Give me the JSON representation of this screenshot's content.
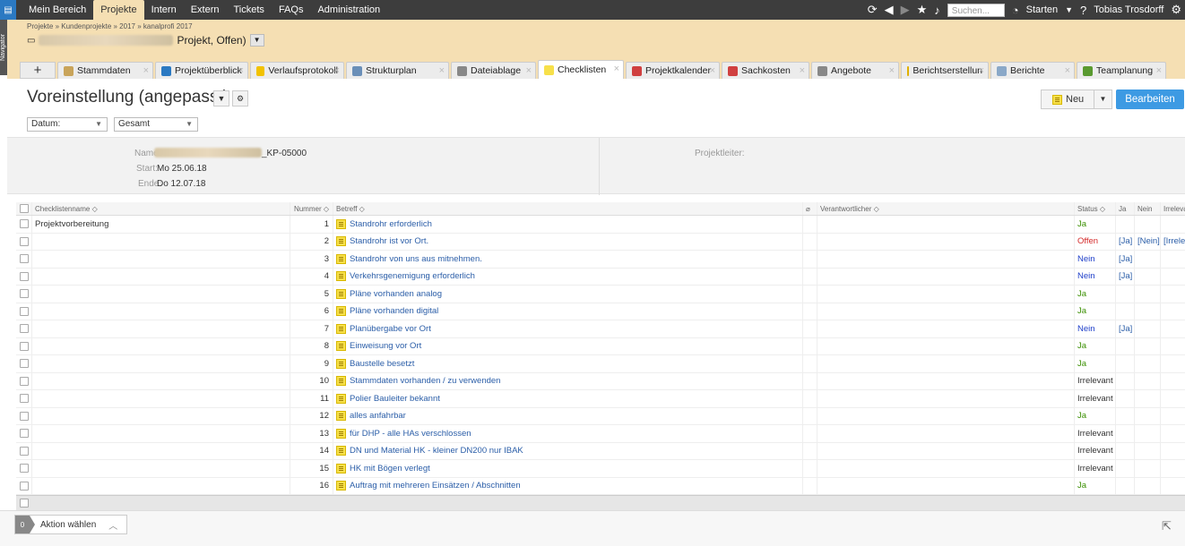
{
  "topnav": {
    "items": [
      "Mein Bereich",
      "Projekte",
      "Intern",
      "Extern",
      "Tickets",
      "FAQs",
      "Administration"
    ],
    "search_placeholder": "Suchen...",
    "starten": "Starten",
    "user": "Tobias Trosdorff"
  },
  "navigator_label": "Navigator",
  "project": {
    "breadcrumb": "Projekte » Kundenprojekte » 2017 » kanalprofi 2017",
    "title_suffix": "Projekt, Offen)"
  },
  "tabs": [
    {
      "label": "Stammdaten",
      "color": "#c9a45a"
    },
    {
      "label": "Projektüberblick",
      "color": "#2b79c2"
    },
    {
      "label": "Verlaufsprotokoll",
      "color": "#f2c200"
    },
    {
      "label": "Strukturplan",
      "color": "#6a8fb8"
    },
    {
      "label": "Dateiablage",
      "color": "#888888"
    },
    {
      "label": "Checklisten",
      "color": "#f7e04a"
    },
    {
      "label": "Projektkalender",
      "color": "#d04040"
    },
    {
      "label": "Sachkosten",
      "color": "#d04040"
    },
    {
      "label": "Angebote",
      "color": "#888888"
    },
    {
      "label": "Berichtserstellun",
      "color": "#e0b000"
    },
    {
      "label": "Berichte",
      "color": "#8aa8c8"
    },
    {
      "label": "Teamplanung",
      "color": "#5a9a30"
    }
  ],
  "view": {
    "title": "Voreinstellung (angepasst)",
    "new_label": "Neu",
    "edit_label": "Bearbeiten"
  },
  "filters": {
    "datum": "Datum:",
    "gesamt": "Gesamt"
  },
  "info": {
    "name_label": "Name:",
    "name_value": "_KP-05000",
    "start_label": "Start:",
    "start_value": "Mo 25.06.18",
    "end_label": "Ende:",
    "end_value": "Do 12.07.18",
    "pl_label": "Projektleiter:"
  },
  "columns": {
    "name": "Checklistenname",
    "num": "Nummer",
    "betreff": "Betreff",
    "verantwortlicher": "Verantwortlicher",
    "status": "Status",
    "ja": "Ja",
    "nein": "Nein",
    "irrelevant": "Irrelevant"
  },
  "rows": [
    {
      "name": "Projektvorbereitung",
      "num": "1",
      "betreff": "Standrohr erforderlich",
      "status": "Ja",
      "ja": "",
      "nein": "",
      "irr": ""
    },
    {
      "name": "",
      "num": "2",
      "betreff": "Standrohr ist vor Ort.",
      "status": "Offen",
      "ja": "[Ja]",
      "nein": "[Nein]",
      "irr": "[Irrelevant]"
    },
    {
      "name": "",
      "num": "3",
      "betreff": "Standrohr von uns aus mitnehmen.",
      "status": "Nein",
      "ja": "[Ja]",
      "nein": "",
      "irr": ""
    },
    {
      "name": "",
      "num": "4",
      "betreff": "Verkehrsgenemigung erforderlich",
      "status": "Nein",
      "ja": "[Ja]",
      "nein": "",
      "irr": ""
    },
    {
      "name": "",
      "num": "5",
      "betreff": "Pläne vorhanden analog",
      "status": "Ja",
      "ja": "",
      "nein": "",
      "irr": ""
    },
    {
      "name": "",
      "num": "6",
      "betreff": "Pläne vorhanden digital",
      "status": "Ja",
      "ja": "",
      "nein": "",
      "irr": ""
    },
    {
      "name": "",
      "num": "7",
      "betreff": "Planübergabe vor Ort",
      "status": "Nein",
      "ja": "[Ja]",
      "nein": "",
      "irr": ""
    },
    {
      "name": "",
      "num": "8",
      "betreff": "Einweisung vor Ort",
      "status": "Ja",
      "ja": "",
      "nein": "",
      "irr": ""
    },
    {
      "name": "",
      "num": "9",
      "betreff": "Baustelle besetzt",
      "status": "Ja",
      "ja": "",
      "nein": "",
      "irr": ""
    },
    {
      "name": "",
      "num": "10",
      "betreff": "Stammdaten vorhanden / zu verwenden",
      "status": "Irrelevant",
      "ja": "",
      "nein": "",
      "irr": ""
    },
    {
      "name": "",
      "num": "11",
      "betreff": "Polier Bauleiter bekannt",
      "status": "Irrelevant",
      "ja": "",
      "nein": "",
      "irr": ""
    },
    {
      "name": "",
      "num": "12",
      "betreff": "alles anfahrbar",
      "status": "Ja",
      "ja": "",
      "nein": "",
      "irr": ""
    },
    {
      "name": "",
      "num": "13",
      "betreff": "für DHP - alle HAs verschlossen",
      "status": "Irrelevant",
      "ja": "",
      "nein": "",
      "irr": ""
    },
    {
      "name": "",
      "num": "14",
      "betreff": "DN und Material HK - kleiner DN200 nur IBAK",
      "status": "Irrelevant",
      "ja": "",
      "nein": "",
      "irr": ""
    },
    {
      "name": "",
      "num": "15",
      "betreff": "HK mit Bögen verlegt",
      "status": "Irrelevant",
      "ja": "",
      "nein": "",
      "irr": ""
    },
    {
      "name": "",
      "num": "16",
      "betreff": "Auftrag mit mehreren Einsätzen / Abschnitten",
      "status": "Ja",
      "ja": "",
      "nein": "",
      "irr": ""
    }
  ],
  "footer": {
    "count": "0",
    "aktion": "Aktion wählen"
  }
}
